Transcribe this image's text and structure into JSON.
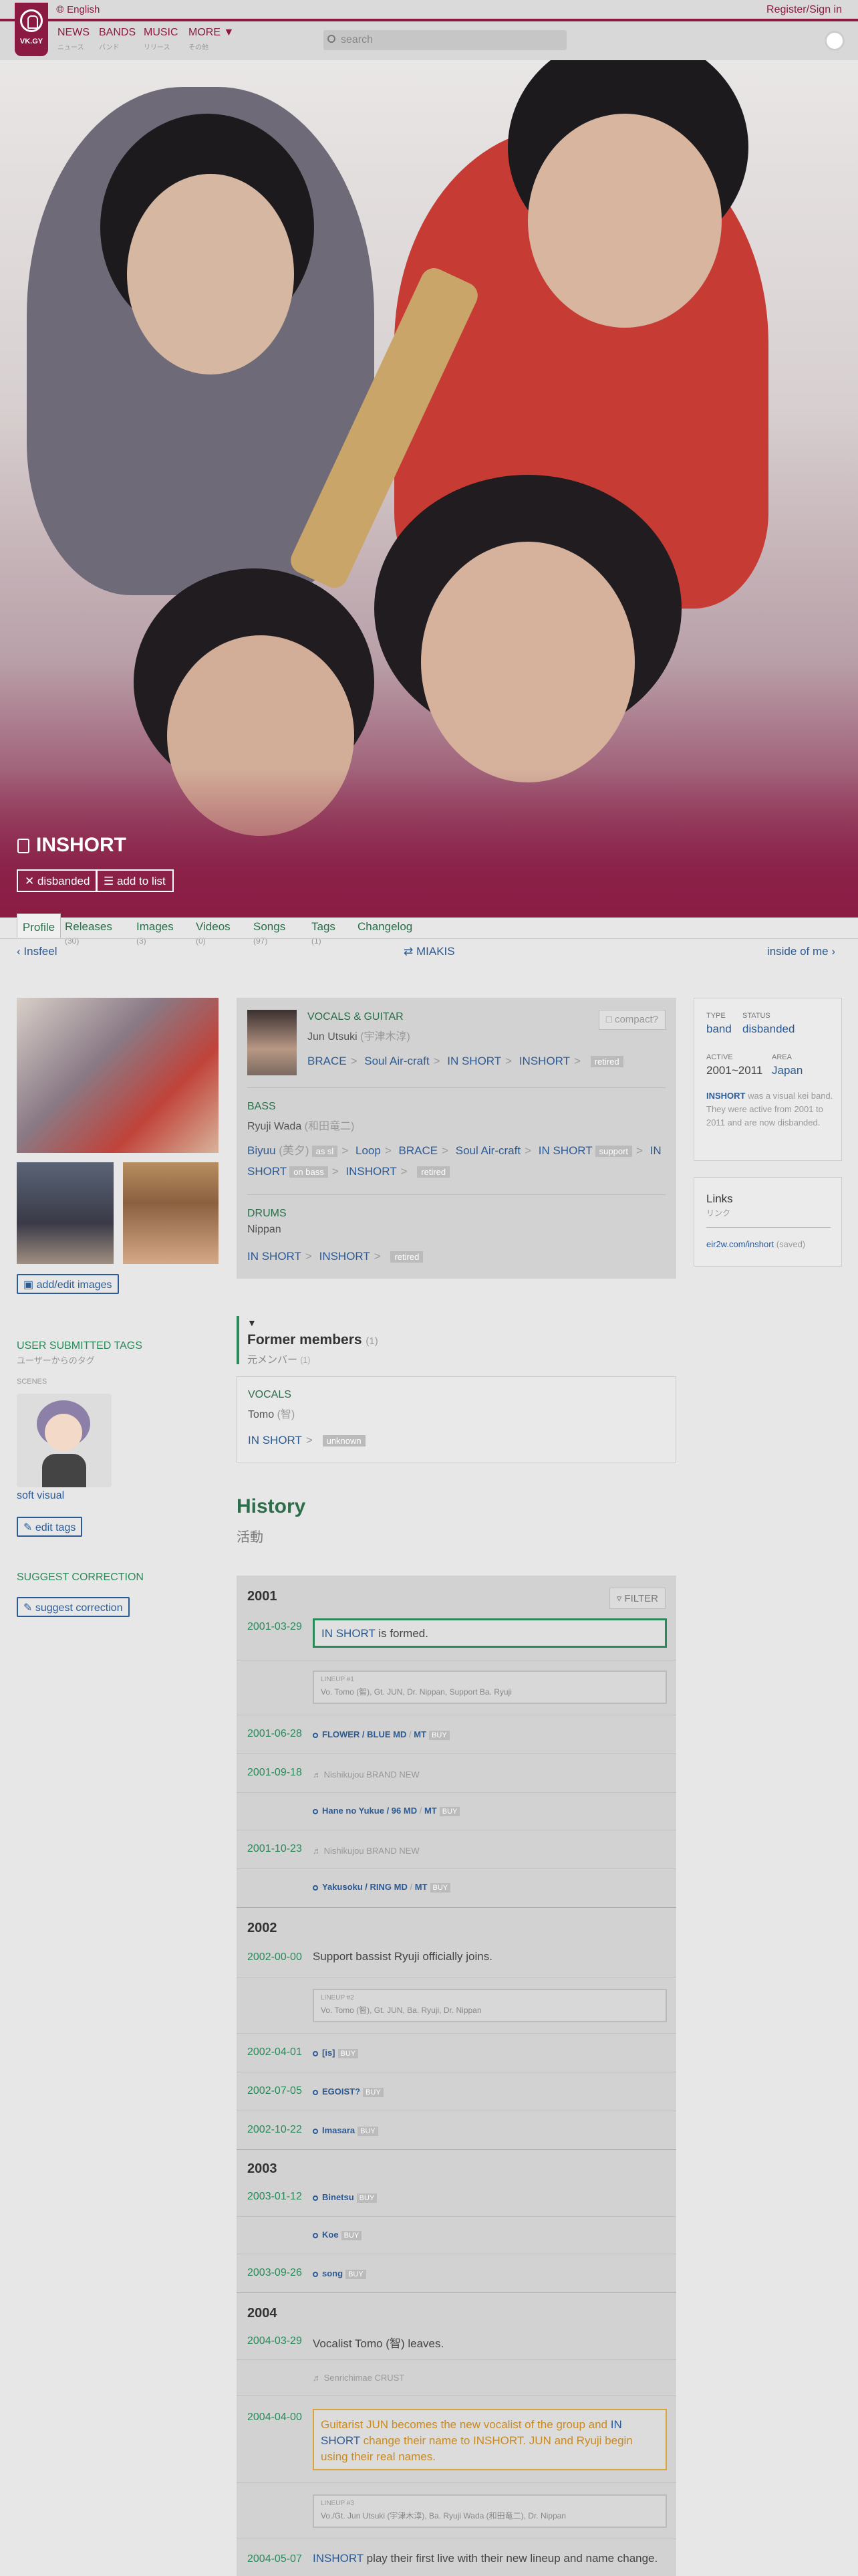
{
  "header": {
    "logo_text": "VK.GY",
    "language": "English",
    "signin": "Register/Sign in",
    "nav": [
      {
        "label": "NEWS",
        "sub": "ニュース"
      },
      {
        "label": "BANDS",
        "sub": "バンド"
      },
      {
        "label": "MUSIC",
        "sub": "リリース"
      },
      {
        "label": "MORE",
        "sub": "その他"
      }
    ],
    "search_placeholder": "search"
  },
  "artist": {
    "name": "INSHORT",
    "status_pill": "disbanded",
    "add_pill": "add to list"
  },
  "tabs": [
    {
      "label": "Profile",
      "count": ""
    },
    {
      "label": "Releases",
      "count": "(30)"
    },
    {
      "label": "Images",
      "count": "(3)"
    },
    {
      "label": "Videos",
      "count": "(0)"
    },
    {
      "label": "Songs",
      "count": "(97)"
    },
    {
      "label": "Tags",
      "count": "(1)"
    },
    {
      "label": "Changelog",
      "count": ""
    }
  ],
  "prevnext": {
    "prev": "Insfeel",
    "random": "MIAKIS",
    "next": "inside of me"
  },
  "left": {
    "add_images": "add/edit images",
    "tags_heading": "USER SUBMITTED TAGS",
    "tags_sub": "ユーザーからのタグ",
    "scenes_label": "SCENES",
    "scene_tag": "soft visual",
    "edit_tags": "edit tags",
    "correction_heading": "SUGGEST CORRECTION",
    "correction_button": "suggest correction"
  },
  "members": {
    "compact": "compact?",
    "m1": {
      "role": "VOCALS & GUITAR",
      "name": "Jun Utsuki",
      "name_jp": "(宇津木淳)",
      "bands": [
        "BRACE",
        "Soul Air-craft",
        "IN SHORT",
        "INSHORT"
      ],
      "tag": "retired"
    },
    "m2": {
      "role": "BASS",
      "name": "Ryuji Wada",
      "name_jp": "(和田竜二)",
      "b1": "Biyuu",
      "b1_jp": "(美夕)",
      "b1_tag": "as sl",
      "b2": "Loop",
      "b3": "BRACE",
      "b4": "Soul Air-craft",
      "b5": "IN SHORT",
      "b5_tag": "support",
      "b6": "IN",
      "b6b": "SHORT",
      "b6_tag": "on bass",
      "b7": "INSHORT",
      "tag": "retired"
    },
    "m3": {
      "role": "DRUMS",
      "name": "Nippan",
      "bands": [
        "IN SHORT",
        "INSHORT"
      ],
      "tag": "retired"
    }
  },
  "former": {
    "title": "Former members",
    "count": "(1)",
    "sub": "元メンバー",
    "sub_count": "(1)",
    "role": "VOCALS",
    "name": "Tomo",
    "name_jp": "(智)",
    "band": "IN SHORT",
    "tag": "unknown"
  },
  "info": {
    "type_label": "TYPE",
    "type": "band",
    "status_label": "STATUS",
    "status": "disbanded",
    "active_label": "ACTIVE",
    "active": "2001~2011",
    "area_label": "AREA",
    "area": "Japan",
    "desc_name": "INSHORT",
    "desc": " was a visual kei band. They were active from 2001 to 2011 and are now disbanded.",
    "links_title": "Links",
    "links_sub": "リンク",
    "link": "eir2w.com/inshort",
    "link_note": "(saved)"
  },
  "history": {
    "title": "History",
    "sub": "活動",
    "filter": "FILTER",
    "y2001": "2001",
    "e1_date": "2001-03-29",
    "e1_band": "IN SHORT",
    "e1_text": " is formed.",
    "lineup1_t": "LINEUP #1",
    "lineup1": "Vo. Tomo (智), Gt. JUN, Dr. Nippan, Support Ba. Ryuji",
    "e2_date": "2001-06-28",
    "e2_rel": "FLOWER / BLUE MD",
    "e2_fmt": "MT",
    "e3_date": "2001-09-18",
    "e3_muted": "Nishikujou BRAND NEW",
    "e3_rel": "Hane no Yukue / 96 MD",
    "e3_fmt": "MT",
    "e4_date": "2001-10-23",
    "e4_muted": "Nishikujou BRAND NEW",
    "e4_rel": "Yakusoku / RING MD",
    "e4_fmt": "MT",
    "y2002": "2002",
    "e5_date": "2002-00-00",
    "e5_text": "Support bassist Ryuji officially joins.",
    "lineup2_t": "LINEUP #2",
    "lineup2": "Vo. Tomo (智), Gt. JUN, Ba. Ryuji, Dr. Nippan",
    "e6_date": "2002-04-01",
    "e6_rel": "[is]",
    "e7_date": "2002-07-05",
    "e7_rel": "EGOIST?",
    "e8_date": "2002-10-22",
    "e8_rel": "Imasara",
    "y2003": "2003",
    "e9_date": "2003-01-12",
    "e9_rel": "Binetsu",
    "e9b_rel": "Koe",
    "e10_date": "2003-09-26",
    "e10_rel": "song",
    "y2004": "2004",
    "e11_date": "2004-03-29",
    "e11_text": "Vocalist Tomo (智) leaves.",
    "e11_muted": "Senrichimae CRUST",
    "e12_date": "2004-04-00",
    "e12_text_a": "Guitarist JUN becomes the new vocalist of the group and ",
    "e12_band": "IN SHORT",
    "e12_text_b": " change their name to INSHORT. JUN and Ryuji begin using their real names.",
    "lineup3_t": "LINEUP #3",
    "lineup3": "Vo./Gt. Jun Utsuki (宇津木淳), Ba. Ryuji Wada (和田竜二), Dr. Nippan",
    "e13_date": "2004-05-07",
    "e13_band": "INSHORT",
    "e13_text": " play their first live with their new lineup and name change.",
    "buy": "BUY"
  },
  "colors": {
    "brand": "#8b1a42",
    "accent_green": "#2b8a5a",
    "link_blue": "#2b5a94"
  }
}
